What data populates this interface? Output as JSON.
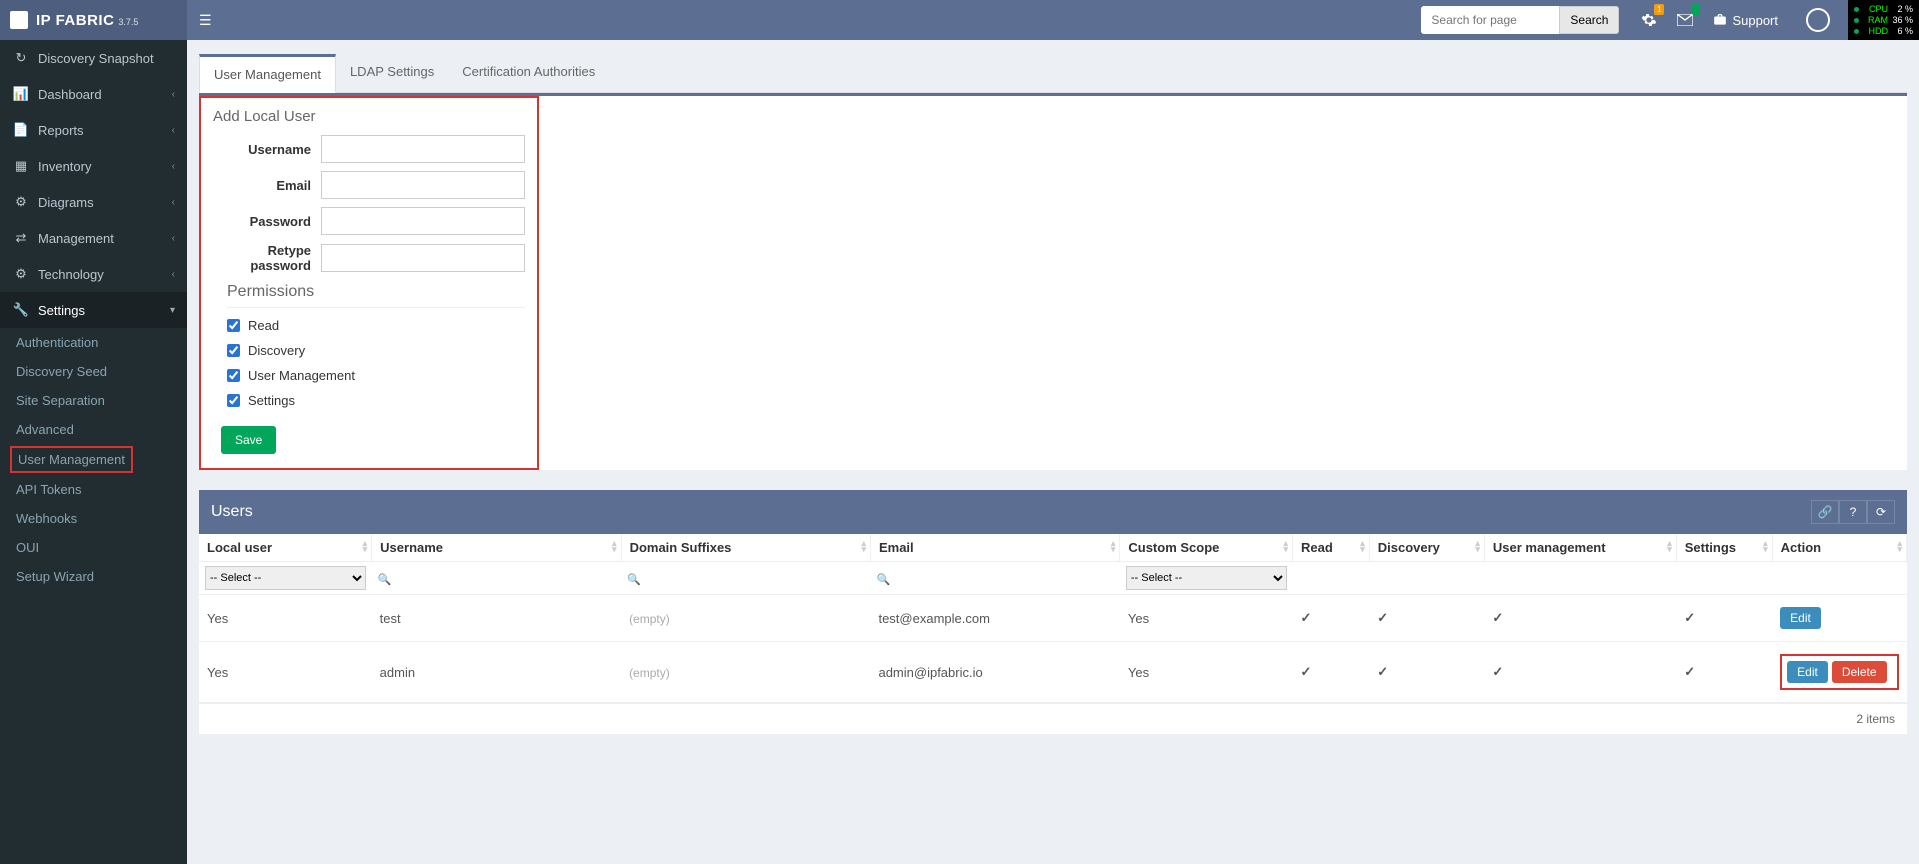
{
  "app": {
    "name": "IP FABRIC",
    "version": "3.7.5"
  },
  "search": {
    "placeholder": "Search for page",
    "button": "Search"
  },
  "topIcons": {
    "gear_badge": "1",
    "support": "Support"
  },
  "sysStats": [
    {
      "label": "CPU",
      "value": "2 %"
    },
    {
      "label": "RAM",
      "value": "36 %"
    },
    {
      "label": "HDD",
      "value": "6 %"
    }
  ],
  "sidebar": {
    "main": [
      {
        "icon": "↻",
        "label": "Discovery Snapshot",
        "chev": false
      },
      {
        "icon": "📊",
        "label": "Dashboard",
        "chev": true
      },
      {
        "icon": "📄",
        "label": "Reports",
        "chev": true
      },
      {
        "icon": "▦",
        "label": "Inventory",
        "chev": true
      },
      {
        "icon": "⚙",
        "label": "Diagrams",
        "chev": true
      },
      {
        "icon": "⇄",
        "label": "Management",
        "chev": true
      },
      {
        "icon": "⚙",
        "label": "Technology",
        "chev": true
      },
      {
        "icon": "🔧",
        "label": "Settings",
        "chev": true,
        "active": true
      }
    ],
    "sub": [
      "Authentication",
      "Discovery Seed",
      "Site Separation",
      "Advanced",
      "User Management",
      "API Tokens",
      "Webhooks",
      "OUI",
      "Setup Wizard"
    ]
  },
  "tabs": [
    "User Management",
    "LDAP Settings",
    "Certification Authorities"
  ],
  "addUser": {
    "title": "Add Local User",
    "fields": {
      "username": "Username",
      "email": "Email",
      "password": "Password",
      "retype": "Retype password"
    },
    "permTitle": "Permissions",
    "perms": [
      "Read",
      "Discovery",
      "User Management",
      "Settings"
    ],
    "save": "Save"
  },
  "usersPanel": {
    "title": "Users",
    "columns": [
      "Local user",
      "Username",
      "Domain Suffixes",
      "Email",
      "Custom Scope",
      "Read",
      "Discovery",
      "User management",
      "Settings",
      "Action"
    ],
    "selectPlaceholder": "-- Select --",
    "empty": "(empty)",
    "rows": [
      {
        "local": "Yes",
        "user": "test",
        "email": "test@example.com",
        "scope": "Yes",
        "actions": [
          "Edit"
        ]
      },
      {
        "local": "Yes",
        "user": "admin",
        "email": "admin@ipfabric.io",
        "scope": "Yes",
        "actions": [
          "Edit",
          "Delete"
        ]
      }
    ],
    "footer": "2 items",
    "editLabel": "Edit",
    "deleteLabel": "Delete"
  }
}
